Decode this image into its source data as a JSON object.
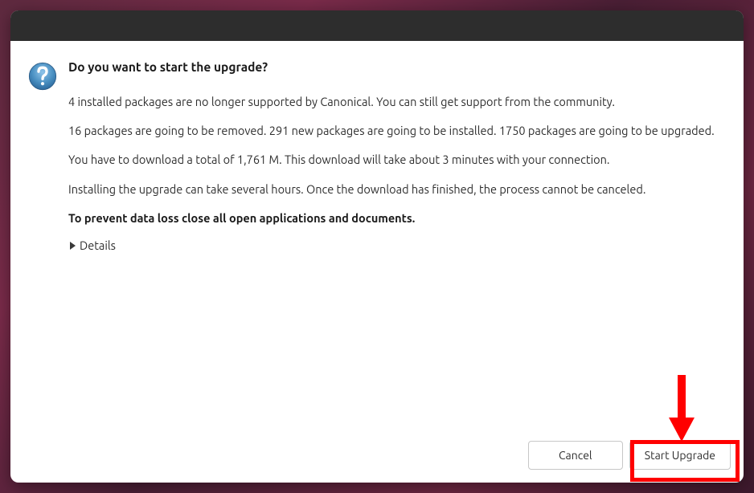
{
  "dialog": {
    "title": "Do you want to start the upgrade?",
    "lines": {
      "unsupported": "4 installed packages are no longer supported by Canonical. You can still get support from the community.",
      "packages": "16 packages are going to be removed. 291 new packages are going to be installed. 1750 packages are going to be upgraded.",
      "download": "You have to download a total of 1,761 M. This download will take about 3 minutes with your connection.",
      "installing": "Installing the upgrade can take several hours. Once the download has finished, the process cannot be canceled.",
      "warning": "To prevent data loss close all open applications and documents."
    },
    "details_label": "Details",
    "buttons": {
      "cancel": "Cancel",
      "start": "Start Upgrade"
    }
  }
}
